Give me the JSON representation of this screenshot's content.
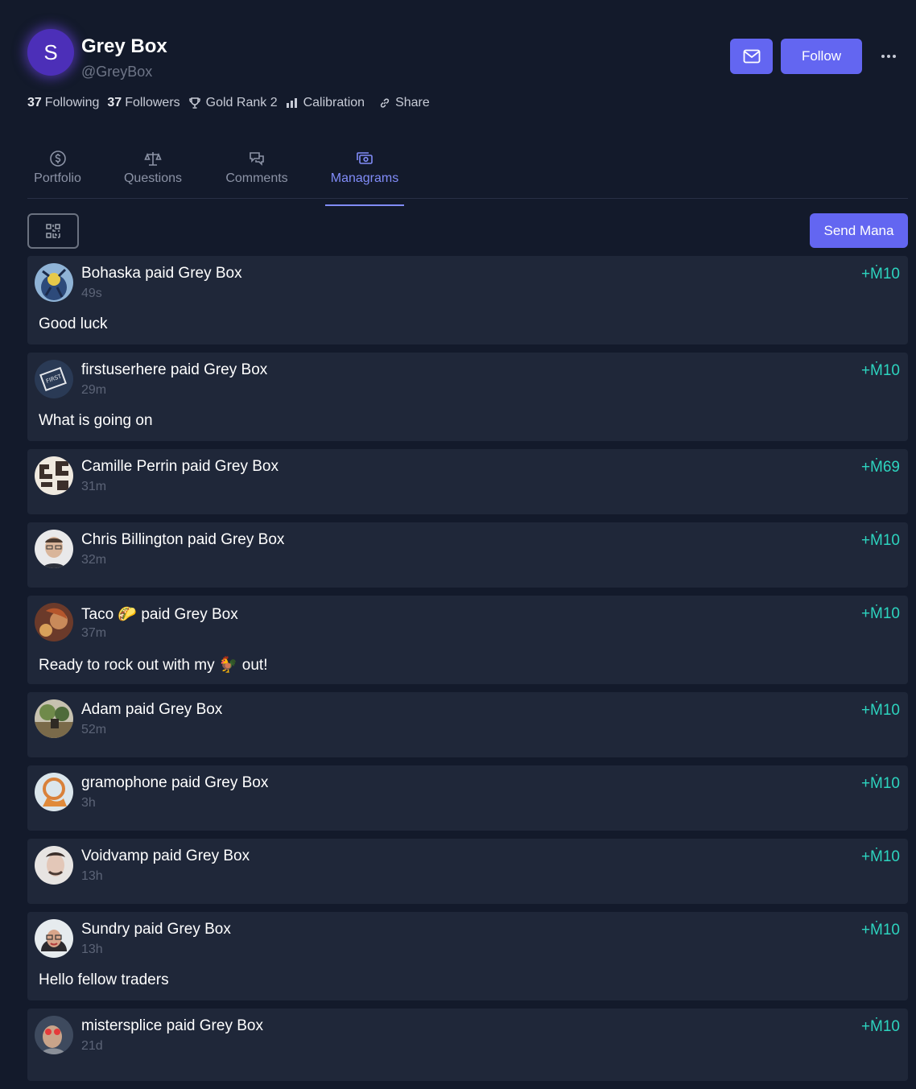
{
  "profile": {
    "initial": "S",
    "name": "Grey Box",
    "handle": "@GreyBox",
    "following_count": "37",
    "following_label": "Following",
    "followers_count": "37",
    "followers_label": "Followers",
    "rank_label": "Gold Rank 2",
    "calibration_label": "Calibration",
    "share_label": "Share",
    "follow_label": "Follow"
  },
  "tabs": [
    {
      "label": "Portfolio",
      "icon": "dollar-circle-icon"
    },
    {
      "label": "Questions",
      "icon": "scale-icon"
    },
    {
      "label": "Comments",
      "icon": "chat-bubbles-icon"
    },
    {
      "label": "Managrams",
      "icon": "cash-icon",
      "active": true
    }
  ],
  "toolbar": {
    "send_label": "Send Mana"
  },
  "colors": {
    "background": "#131a2b",
    "card": "#1f2739",
    "accent": "#6366f1",
    "amount": "#2dd4bf"
  },
  "managrams": [
    {
      "title": "Bohaska paid Grey Box",
      "time": "49s",
      "amount": "+Ṁ10",
      "message": "Good luck",
      "avatar": "av1"
    },
    {
      "title": "firstuserhere paid Grey Box",
      "time": "29m",
      "amount": "+Ṁ10",
      "message": "What is going on",
      "avatar": "av2"
    },
    {
      "title": "Camille Perrin paid Grey Box",
      "time": "31m",
      "amount": "+Ṁ69",
      "message": "",
      "avatar": "av3"
    },
    {
      "title": "Chris Billington paid Grey Box",
      "time": "32m",
      "amount": "+Ṁ10",
      "message": "",
      "avatar": "av4"
    },
    {
      "title": "Taco 🌮 paid Grey Box",
      "time": "37m",
      "amount": "+Ṁ10",
      "message": "Ready to rock out with my 🐓 out!",
      "avatar": "av5"
    },
    {
      "title": "Adam paid Grey Box",
      "time": "52m",
      "amount": "+Ṁ10",
      "message": "",
      "avatar": "av6"
    },
    {
      "title": "gramophone paid Grey Box",
      "time": "3h",
      "amount": "+Ṁ10",
      "message": "",
      "avatar": "av7"
    },
    {
      "title": "Voidvamp paid Grey Box",
      "time": "13h",
      "amount": "+Ṁ10",
      "message": "",
      "avatar": "av8"
    },
    {
      "title": "Sundry paid Grey Box",
      "time": "13h",
      "amount": "+Ṁ10",
      "message": "Hello fellow traders",
      "avatar": "av9"
    },
    {
      "title": "mistersplice paid Grey Box",
      "time": "21d",
      "amount": "+Ṁ10",
      "message": "",
      "avatar": "av10"
    }
  ]
}
